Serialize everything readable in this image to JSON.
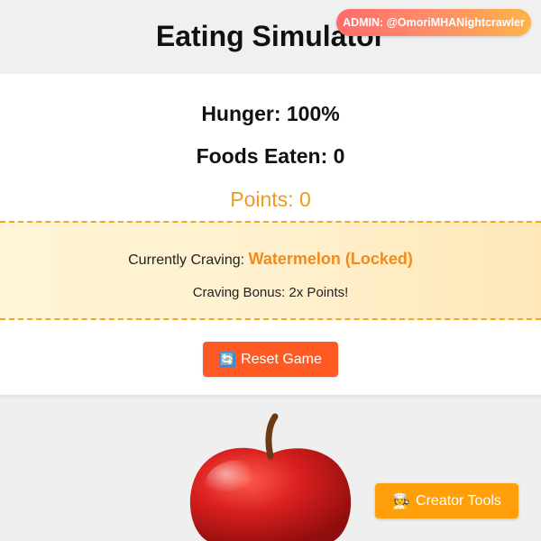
{
  "header": {
    "title": "Eating Simulator",
    "admin_badge": "ADMIN: @OmoriMHANightcrawler"
  },
  "stats": {
    "hunger": "Hunger: 100%",
    "foods_eaten": "Foods Eaten: 0",
    "points": "Points: 0"
  },
  "craving": {
    "label": "Currently Craving: ",
    "food": "Watermelon (Locked)",
    "bonus": "Craving Bonus: 2x Points!"
  },
  "buttons": {
    "reset_icon": "🔄",
    "reset_label": "Reset Game",
    "creator_icon": "🧑‍🍳",
    "creator_label": "Creator Tools"
  },
  "colors": {
    "points": "#f29a1c",
    "craving_food": "#f28a1c",
    "reset_button": "#ff5a24",
    "creator_button": "#ff9f0a"
  },
  "icons": {
    "reset": "refresh-icon",
    "creator": "chef-icon",
    "food": "apple-icon"
  }
}
